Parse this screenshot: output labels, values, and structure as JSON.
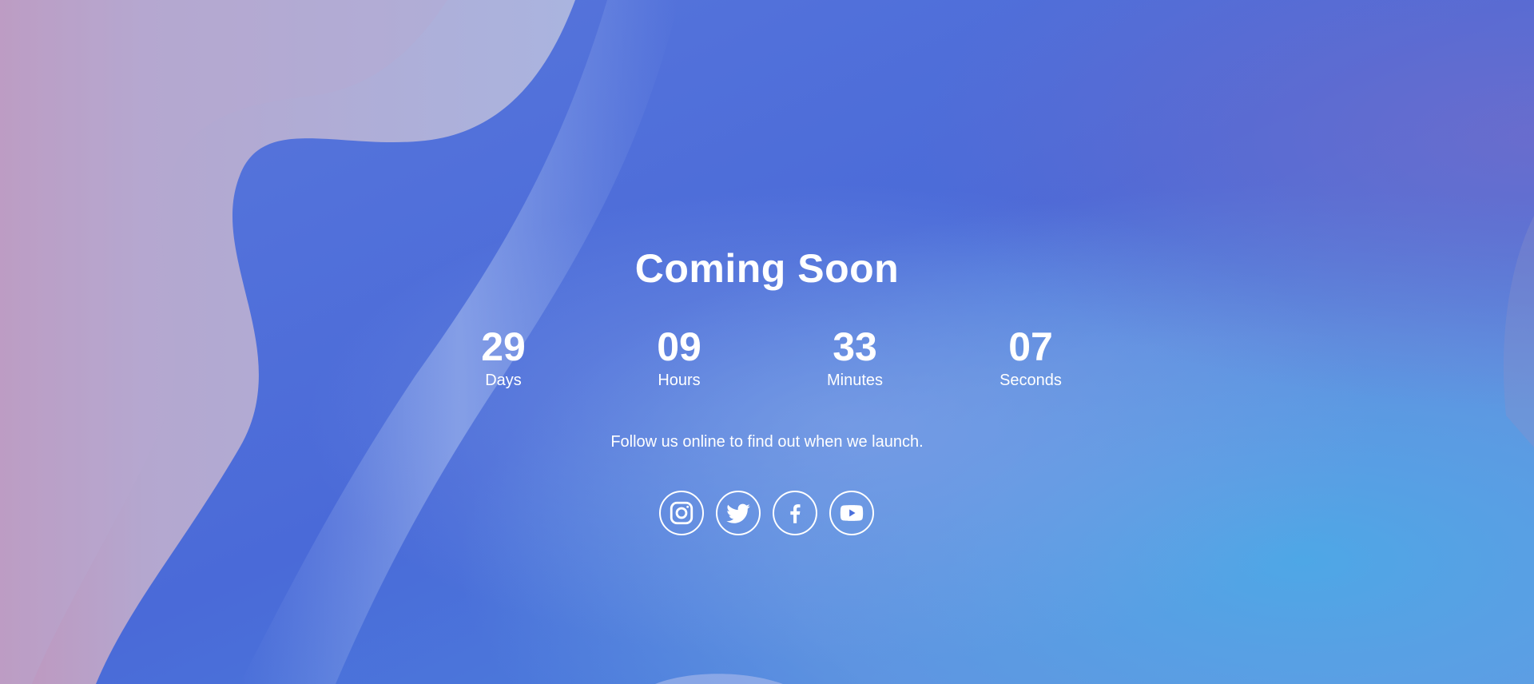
{
  "page": {
    "title": "Coming Soon",
    "tagline": "Follow us online to find out when we launch."
  },
  "countdown": [
    {
      "value": "29",
      "label": "Days"
    },
    {
      "value": "09",
      "label": "Hours"
    },
    {
      "value": "33",
      "label": "Minutes"
    },
    {
      "value": "07",
      "label": "Seconds"
    }
  ],
  "socials": [
    {
      "icon": "instagram-icon"
    },
    {
      "icon": "twitter-icon"
    },
    {
      "icon": "facebook-icon"
    },
    {
      "icon": "youtube-icon"
    }
  ],
  "colors": {
    "text": "#ffffff",
    "bg_blue": "#4a6fdc",
    "bg_lavender": "#b3aed6",
    "bg_pink": "#c08fb8",
    "bg_cyan": "#4ea7e6"
  }
}
